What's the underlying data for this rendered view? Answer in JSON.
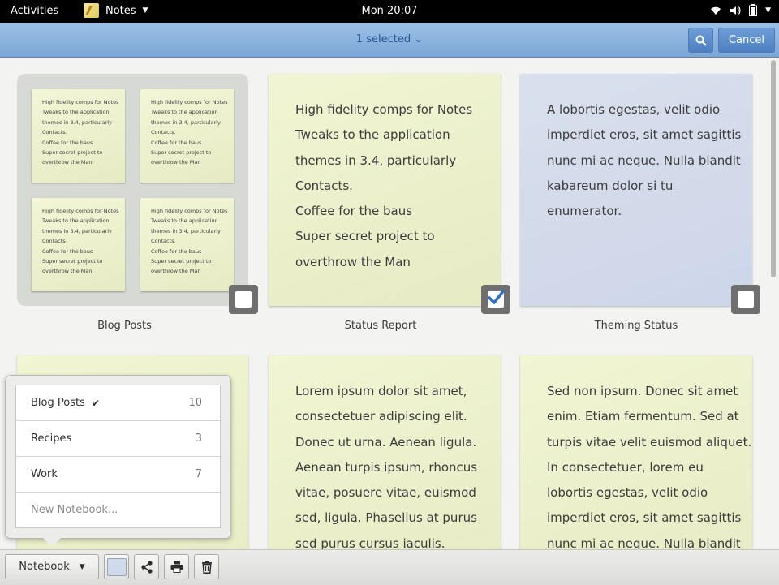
{
  "topbar": {
    "activities": "Activities",
    "app_name": "Notes",
    "clock": "Mon 20:07",
    "icons": [
      "wifi-icon",
      "volume-icon",
      "battery-icon",
      "chevron-down-icon"
    ]
  },
  "header": {
    "selection_label": "1 selected",
    "cancel_label": "Cancel",
    "search_icon": "search-icon",
    "accent": "#7aa6d6"
  },
  "notebook_tile": {
    "caption": "Blog Posts",
    "selected": false,
    "minis": [
      [
        "High fidelity comps for Notes",
        "Tweaks to the application",
        "themes in 3.4, particularly",
        "Contacts.",
        "Coffee for the baus",
        "Super secret project to",
        "overthrow the Man"
      ],
      [
        "High fidelity comps for Notes",
        "Tweaks to the application",
        "themes in 3.4, particularly",
        "Contacts.",
        "Coffee for the baus",
        "Super secret project to",
        "overthrow the Man"
      ],
      [
        "High fidelity comps for Notes",
        "Tweaks to the application",
        "themes in 3.4, particularly",
        "Contacts.",
        "Coffee for the baus",
        "Super secret project to",
        "overthrow the Man"
      ],
      [
        "High fidelity comps for Notes",
        "Tweaks to the application",
        "themes in 3.4, particularly",
        "Contacts.",
        "Coffee for the baus",
        "Super secret project to",
        "overthrow the Man"
      ]
    ]
  },
  "notes": [
    {
      "caption": "Status Report",
      "selected": true,
      "lines": [
        "High fidelity comps for Notes",
        "Tweaks to the application",
        "themes in 3.4, particularly",
        "Contacts.",
        "Coffee for the baus",
        "Super secret project to",
        "overthrow the Man"
      ]
    },
    {
      "caption": "Theming Status",
      "selected": false,
      "color": "blue",
      "lines": [
        "A lobortis egestas, velit odio",
        "imperdiet eros, sit amet sagittis",
        "nunc mi ac neque. Nulla blandit",
        "kabareum dolor si tu",
        "enumerator."
      ]
    },
    {
      "lines": [
        "Lorem ipsum dolor sit amet,",
        "consectetuer adipiscing elit.",
        "Donec ut urna. Aenean ligula.",
        "Aenean turpis ipsum, rhoncus",
        "vitae, posuere vitae, euismod",
        "sed, ligula. Phasellus at purus",
        "sed purus cursus iaculis."
      ]
    },
    {
      "lines": [
        "Sed non ipsum. Donec sit amet",
        "enim. Etiam fermentum. Sed at",
        "turpis vitae velit euismod aliquet.",
        "In consectetuer, lorem eu",
        "lobortis egestas, velit odio",
        "imperdiet eros, sit amet sagittis",
        "nunc mi ac neque. Nulla blandit"
      ]
    }
  ],
  "popover": {
    "notebooks": [
      {
        "name": "Blog Posts",
        "count": "10",
        "checked": true
      },
      {
        "name": "Recipes",
        "count": "3",
        "checked": false
      },
      {
        "name": "Work",
        "count": "7",
        "checked": false
      }
    ],
    "new_notebook_placeholder": "New Notebook..."
  },
  "toolbar": {
    "notebook_label": "Notebook",
    "icons": [
      "color-swatch",
      "share-icon",
      "print-icon",
      "trash-icon"
    ],
    "swatch_color": "#cfdaea"
  }
}
